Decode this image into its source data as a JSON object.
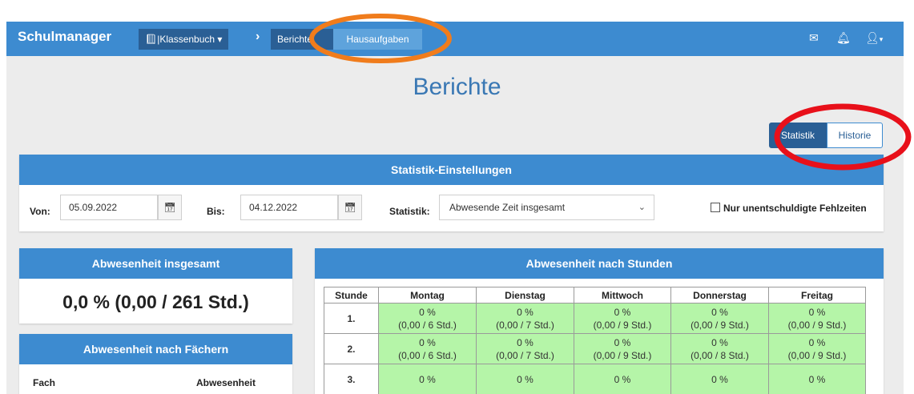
{
  "navbar": {
    "brand": "Schulmanager",
    "classbook_label": "Klassenbuch",
    "breadcrumb_reports": "Berichte",
    "breadcrumb_homework": "Hausaufgaben"
  },
  "page_title": "Berichte",
  "view_toggle": {
    "statistics": "Statistik",
    "history": "Historie"
  },
  "settings": {
    "header": "Statistik-Einstellungen",
    "from_label": "Von:",
    "from_value": "05.09.2022",
    "to_label": "Bis:",
    "to_value": "04.12.2022",
    "stat_label": "Statistik:",
    "stat_value": "Abwesende Zeit insgesamt",
    "unexcused_label": "Nur unentschuldigte Fehlzeiten"
  },
  "absence_total": {
    "header": "Abwesenheit insgesamt",
    "value": "0,0 % (0,00 / 261 Std.)"
  },
  "absence_by_subject": {
    "header": "Abwesenheit nach Fächern",
    "col_subject": "Fach",
    "col_absence": "Abwesenheit"
  },
  "absence_by_hours": {
    "header": "Abwesenheit nach Stunden",
    "columns": [
      "Stunde",
      "Montag",
      "Dienstag",
      "Mittwoch",
      "Donnerstag",
      "Freitag"
    ],
    "rows": [
      {
        "hour": "1.",
        "cells": [
          {
            "pct": "0 %",
            "detail": "(0,00 / 6 Std.)"
          },
          {
            "pct": "0 %",
            "detail": "(0,00 / 7 Std.)"
          },
          {
            "pct": "0 %",
            "detail": "(0,00 / 9 Std.)"
          },
          {
            "pct": "0 %",
            "detail": "(0,00 / 9 Std.)"
          },
          {
            "pct": "0 %",
            "detail": "(0,00 / 9 Std.)"
          }
        ]
      },
      {
        "hour": "2.",
        "cells": [
          {
            "pct": "0 %",
            "detail": "(0,00 / 6 Std.)"
          },
          {
            "pct": "0 %",
            "detail": "(0,00 / 7 Std.)"
          },
          {
            "pct": "0 %",
            "detail": "(0,00 / 9 Std.)"
          },
          {
            "pct": "0 %",
            "detail": "(0,00 / 8 Std.)"
          },
          {
            "pct": "0 %",
            "detail": "(0,00 / 9 Std.)"
          }
        ]
      },
      {
        "hour": "3.",
        "cells": [
          {
            "pct": "0 %",
            "detail": ""
          },
          {
            "pct": "0 %",
            "detail": ""
          },
          {
            "pct": "0 %",
            "detail": ""
          },
          {
            "pct": "0 %",
            "detail": ""
          },
          {
            "pct": "0 %",
            "detail": ""
          }
        ]
      }
    ]
  },
  "colors": {
    "primary": "#3d8bd0",
    "dark": "#2a5f95",
    "cell_green": "#b5f5a8",
    "annotation_orange": "#f07c1c",
    "annotation_red": "#e8101a"
  },
  "icons": [
    "book-icon",
    "chevron-right-icon",
    "calendar-icon",
    "envelope-icon",
    "bell-icon",
    "user-icon",
    "chevron-down-icon"
  ]
}
